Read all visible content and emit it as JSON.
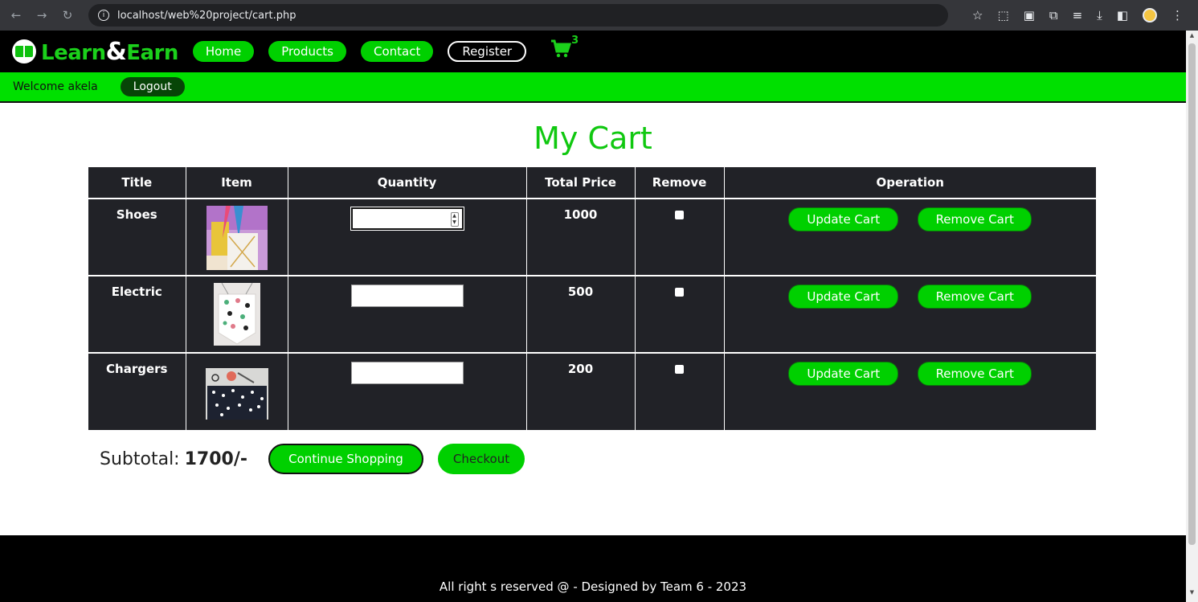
{
  "browser": {
    "url": "localhost/web%20project/cart.php"
  },
  "header": {
    "logo_part1": "Learn",
    "logo_amp": "&",
    "logo_part2": "Earn",
    "nav": [
      "Home",
      "Products",
      "Contact",
      "Register"
    ],
    "cart_count": "3"
  },
  "welcome": {
    "text": "Welcome akela",
    "logout": "Logout"
  },
  "page_title": "My Cart",
  "table": {
    "headers": [
      "Title",
      "Item",
      "Quantity",
      "Total Price",
      "Remove",
      "Operation"
    ],
    "rows": [
      {
        "title": "Shoes",
        "price": "1000",
        "update": "Update Cart",
        "remove": "Remove Cart"
      },
      {
        "title": "Electric",
        "price": "500",
        "update": "Update Cart",
        "remove": "Remove Cart"
      },
      {
        "title": "Chargers",
        "price": "200",
        "update": "Update Cart",
        "remove": "Remove Cart"
      }
    ]
  },
  "subtotal": {
    "label": "Subtotal:",
    "value": "1700/-",
    "continue": "Continue Shopping",
    "checkout": "Checkout"
  },
  "footer": "All right s reserved @ - Designed by Team 6 - 2023",
  "colors": {
    "accent": "#00d000",
    "header_bg": "#000000",
    "table_bg": "#212227"
  }
}
